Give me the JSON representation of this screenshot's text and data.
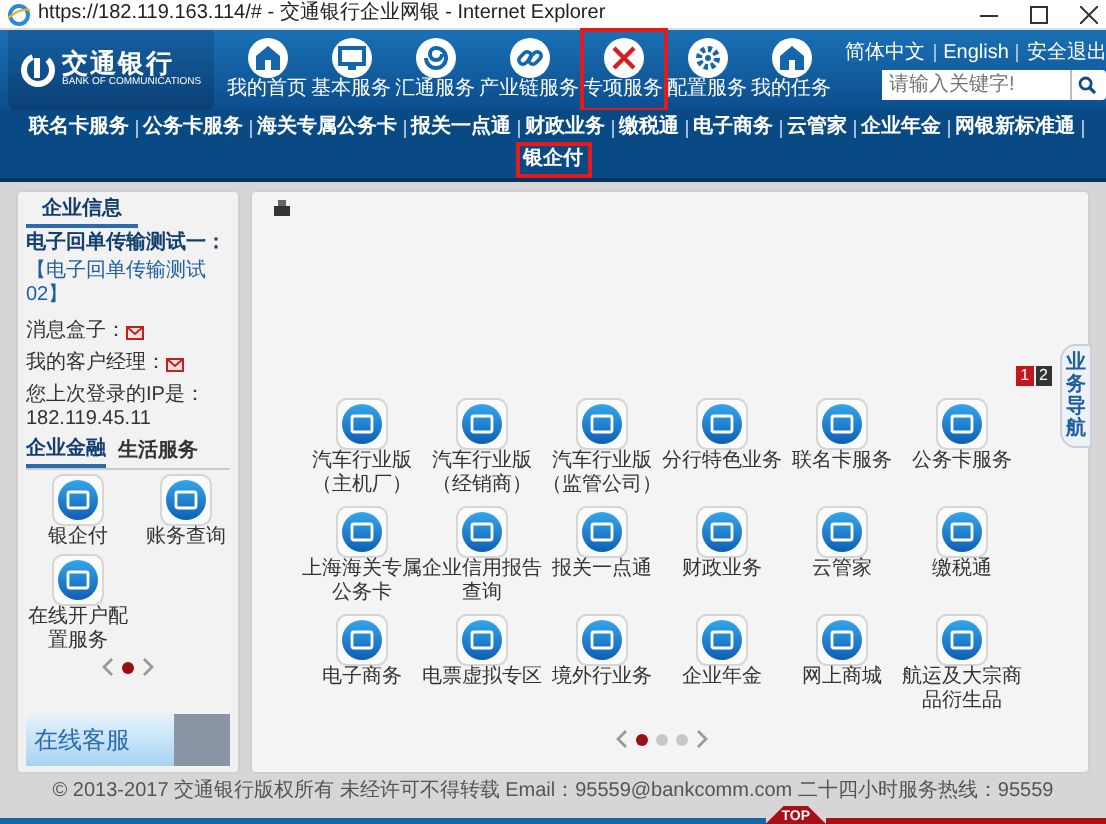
{
  "window": {
    "title": "https://182.119.163.114/# - 交通银行企业网银 - Internet Explorer"
  },
  "header": {
    "logo": {
      "name": "交通银行",
      "subtitle": "BANK OF COMMUNICATIONS"
    },
    "nav": [
      {
        "label": "我的首页",
        "annotated": false
      },
      {
        "label": "基本服务",
        "annotated": false
      },
      {
        "label": "汇通服务",
        "annotated": false
      },
      {
        "label": "产业链服务",
        "annotated": false
      },
      {
        "label": "专项服务",
        "annotated": true
      },
      {
        "label": "配置服务",
        "annotated": false
      },
      {
        "label": "我的任务",
        "annotated": false
      }
    ],
    "links": [
      "简体中文",
      "English",
      "安全退出"
    ],
    "search": {
      "placeholder": "请输入关键字!"
    }
  },
  "subnav": [
    {
      "label": "联名卡服务",
      "annotated": false
    },
    {
      "label": "公务卡服务",
      "annotated": false
    },
    {
      "label": "海关专属公务卡",
      "annotated": false
    },
    {
      "label": "报关一点通",
      "annotated": false
    },
    {
      "label": "财政业务",
      "annotated": false
    },
    {
      "label": "缴税通",
      "annotated": false
    },
    {
      "label": "电子商务",
      "annotated": false
    },
    {
      "label": "云管家",
      "annotated": false
    },
    {
      "label": "企业年金",
      "annotated": false
    },
    {
      "label": "网银新标准通",
      "annotated": false
    },
    {
      "label": "银企付",
      "annotated": true
    }
  ],
  "left_panel": {
    "title": "企业信息",
    "notice_title": "电子回单传输测试一：",
    "notice_body": "【电子回单传输测试02】",
    "info": [
      {
        "label": "消息盒子：",
        "kind": "mail"
      },
      {
        "label": "我的客户经理：",
        "kind": "mail"
      },
      {
        "label": "您上次登录的IP是：",
        "kind": "text",
        "value": "182.119.45.11"
      }
    ],
    "tabs": [
      {
        "label": "企业金融",
        "selected": true
      },
      {
        "label": "生活服务",
        "selected": false
      }
    ],
    "apps": [
      "银企付",
      "账务查询",
      "在线开户配置服务"
    ],
    "pager": [
      {
        "selected": true
      }
    ],
    "banner": "在线客服"
  },
  "main_panel": {
    "page_tabs": [
      {
        "label": "1",
        "selected": true
      },
      {
        "label": "2",
        "selected": false
      }
    ],
    "side_tab": "业务导航",
    "apps": [
      "汽车行业版（主机厂）",
      "汽车行业版（经销商）",
      "汽车行业版（监管公司）",
      "分行特色业务",
      "联名卡服务",
      "公务卡服务",
      "上海海关专属公务卡",
      "企业信用报告查询",
      "报关一点通",
      "财政业务",
      "云管家",
      "缴税通",
      "电子商务",
      "电票虚拟专区",
      "境外行业务",
      "企业年金",
      "网上商城",
      "航运及大宗商品衍生品"
    ],
    "pager": [
      {
        "selected": true
      },
      {
        "selected": false
      },
      {
        "selected": false
      }
    ]
  },
  "footer": "© 2013-2017 交通银行版权所有 未经许可不得转载 Email：95559@bankcomm.com 二十四小时服务热线：95559",
  "top_button": "TOP"
}
